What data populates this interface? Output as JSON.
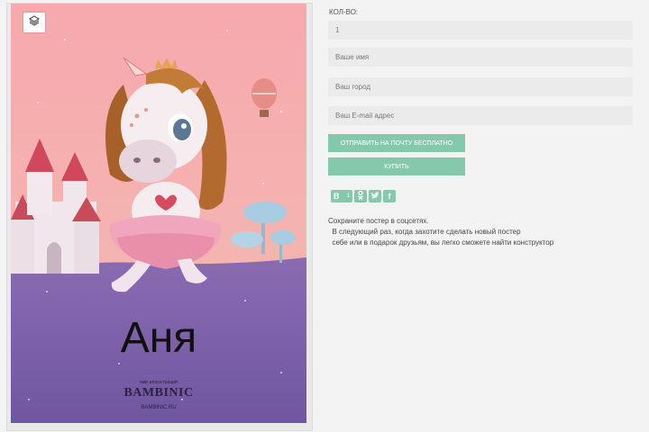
{
  "poster": {
    "name": "Аня",
    "brand_tagline": "мир иллюстраций",
    "brand_name": "BAMBINIC",
    "brand_url": "BAMBINIC.RU"
  },
  "form": {
    "qty_label": "КОЛ-ВО:",
    "qty_value": "1",
    "name_placeholder": "Ваше имя",
    "city_placeholder": "Ваш город",
    "email_placeholder": "Ваш E-mail адрес",
    "send_label": "ОТПРАВИТЬ НА ПОЧТУ БЕСПЛАТНО",
    "buy_label": "КУПИТЬ"
  },
  "share": {
    "vk": "В",
    "vk_count": "1",
    "ok": "ок",
    "twitter": "tw",
    "facebook": "f",
    "icons": [
      "vk-icon",
      "odnoklassniki-icon",
      "twitter-icon",
      "facebook-icon"
    ]
  },
  "info": {
    "line1": "Сохраните постер в соцсетях.",
    "line2": "  В следующий раз, когда захотите сделать новый постер",
    "line3": "  себе или в подарок друзьям, вы легко сможете найти конструктор"
  },
  "colors": {
    "accent": "#85c9ad",
    "poster_sky": "#f7b0b2",
    "poster_ground": "#7a62a6"
  }
}
